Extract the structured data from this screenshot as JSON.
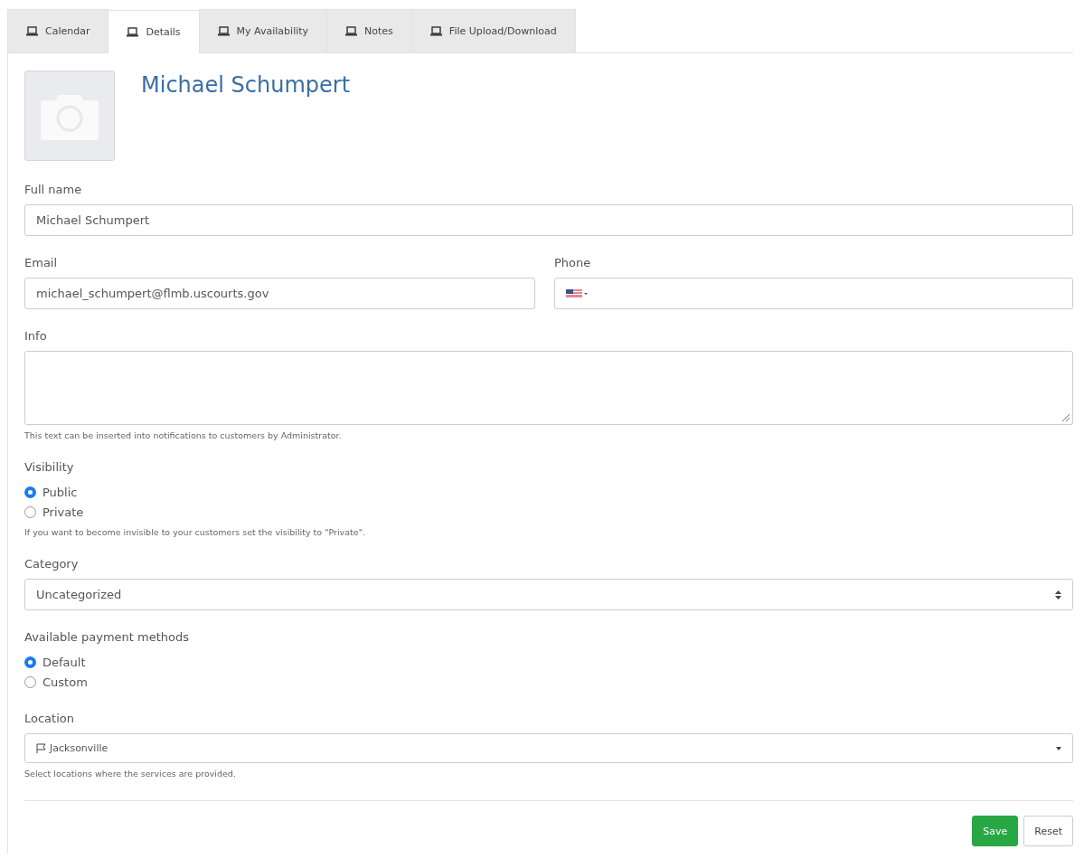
{
  "tabs": [
    {
      "label": "Calendar",
      "selected": false
    },
    {
      "label": "Details",
      "selected": true
    },
    {
      "label": "My Availability",
      "selected": false
    },
    {
      "label": "Notes",
      "selected": false
    },
    {
      "label": "File Upload/Download",
      "selected": false
    }
  ],
  "profile": {
    "name": "Michael Schumpert"
  },
  "full_name": {
    "label": "Full name",
    "value": "Michael Schumpert"
  },
  "email": {
    "label": "Email",
    "value": "michael_schumpert@flmb.uscourts.gov"
  },
  "phone": {
    "label": "Phone"
  },
  "info": {
    "label": "Info",
    "help": "This text can be inserted into notifications to customers by Administrator."
  },
  "visibility": {
    "label": "Visibility",
    "options": [
      {
        "label": "Public",
        "selected": true
      },
      {
        "label": "Private",
        "selected": false
      }
    ],
    "help": "If you want to become invisible to your customers set the visibility to \"Private\"."
  },
  "category": {
    "label": "Category",
    "value": "Uncategorized"
  },
  "payment": {
    "label": "Available payment methods",
    "options": [
      {
        "label": "Default",
        "selected": true
      },
      {
        "label": "Custom",
        "selected": false
      }
    ]
  },
  "location": {
    "label": "Location",
    "value": "Jacksonville",
    "help": "Select locations where the services are provided."
  },
  "buttons": [
    {
      "label": "Save",
      "kind": "primary"
    },
    {
      "label": "Reset",
      "kind": "secondary"
    }
  ]
}
